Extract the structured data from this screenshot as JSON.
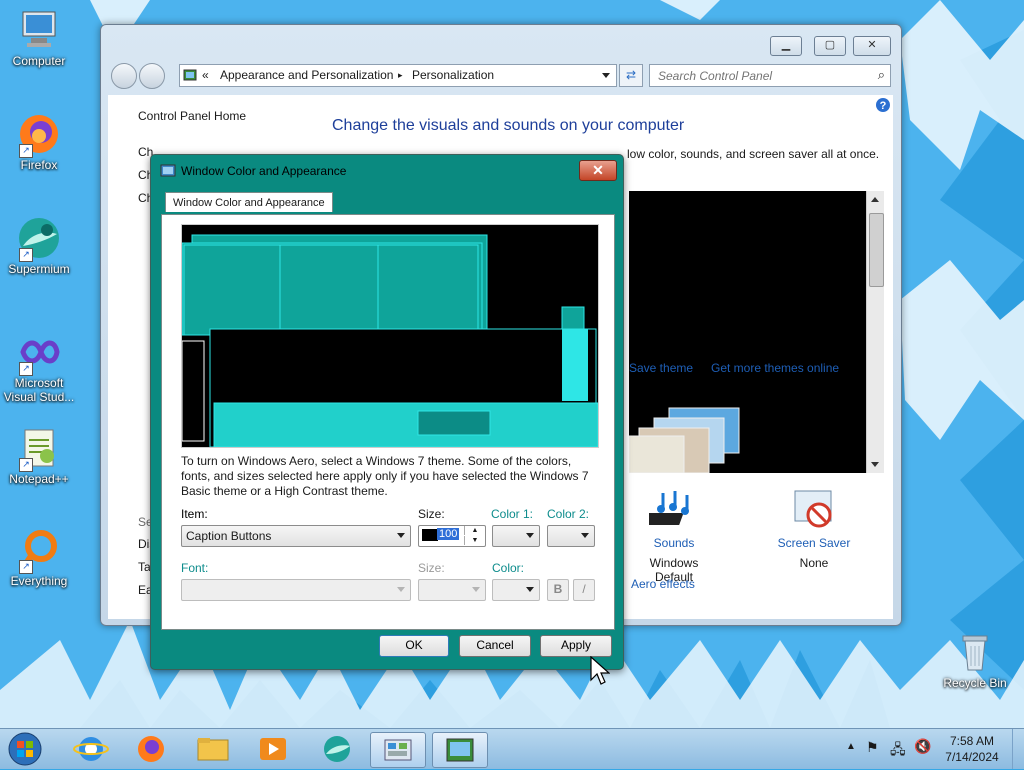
{
  "desktop": {
    "icons": [
      {
        "label": "Computer"
      },
      {
        "label": "Firefox"
      },
      {
        "label": "Supermium"
      },
      {
        "label": "Microsoft Visual Stud..."
      },
      {
        "label": "Notepad++"
      },
      {
        "label": "Everything"
      },
      {
        "label": "Recycle Bin"
      }
    ]
  },
  "control_panel": {
    "address": {
      "root_glyph": "«",
      "crumb1": "Appearance and Personalization",
      "sep": "▸",
      "crumb2": "Personalization"
    },
    "search": {
      "placeholder": "Search Control Panel"
    },
    "left": {
      "home": "Control Panel Home",
      "items": [
        "Ch",
        "Ch",
        "Ch"
      ],
      "see_also": "Se",
      "see_items": [
        "Dis",
        "Ta",
        "Ea"
      ],
      "partial_link": "Change desktop icons"
    },
    "main": {
      "title": "Change the visuals and sounds on your computer",
      "subtitle_visible": "Click a theme to change the desktop background, window color, sounds, and screen saver all at once.",
      "subtitle_right": "low color, sounds, and screen saver all at once.",
      "save_theme": "Save theme",
      "get_more": "Get more themes online",
      "sounds_label": "Sounds",
      "sounds_value": "Windows Default",
      "screensaver_label": "Screen Saver",
      "screensaver_value": "None",
      "aero_effects": "Aero effects"
    }
  },
  "dialog": {
    "title": "Window Color and Appearance",
    "tab": "Window Color and Appearance",
    "info": "To turn on Windows Aero, select a Windows 7 theme.  Some of the colors, fonts, and sizes selected here apply only if you have selected the Windows 7 Basic theme or a High Contrast theme.",
    "item_label": "Item:",
    "item_value": "Caption Buttons",
    "size_label": "Size:",
    "size_value": "100",
    "color1_label": "Color 1:",
    "color2_label": "Color 2:",
    "font_label": "Font:",
    "font_size_label": "Size:",
    "font_color_label": "Color:",
    "bold_label": "B",
    "italic_label": "/",
    "ok": "OK",
    "cancel": "Cancel",
    "apply": "Apply"
  },
  "taskbar": {
    "time": "7:58 AM",
    "date": "7/14/2024"
  },
  "colors": {
    "dialog_frame": "#0a8a80",
    "preview_teal": "#0fa49a",
    "preview_cyan": "#2ee6e6",
    "link": "#1e5eb5"
  }
}
